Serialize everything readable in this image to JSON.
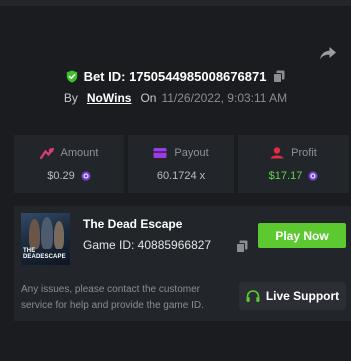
{
  "bet": {
    "label": "Bet ID: 1750544985008676871",
    "by_label": "By",
    "user": "NoWins",
    "on_label": "On",
    "date": "11/26/2022, 9:03:11 AM"
  },
  "stats": {
    "amount": {
      "label": "Amount",
      "value": "$0.29",
      "icon": "amount-icon",
      "color": "#e0397d"
    },
    "payout": {
      "label": "Payout",
      "value": "60.1724 x",
      "icon": "payout-icon",
      "color": "#9b3fdc"
    },
    "profit": {
      "label": "Profit",
      "value": "$17.17",
      "icon": "profit-icon",
      "color": "#e02d3f",
      "value_color": "#5fd84a"
    }
  },
  "game": {
    "title": "The Dead Escape",
    "thumb_title": "THE DEADESCAPE",
    "id_label": "Game ID: 40885966827",
    "play_label": "Play Now"
  },
  "notice": "Any issues, please contact the customer service for help and provide the game ID.",
  "support_label": "Live Support",
  "colors": {
    "background": "#1a1c20",
    "card": "#22252a",
    "accent_green": "#5bc92f"
  }
}
